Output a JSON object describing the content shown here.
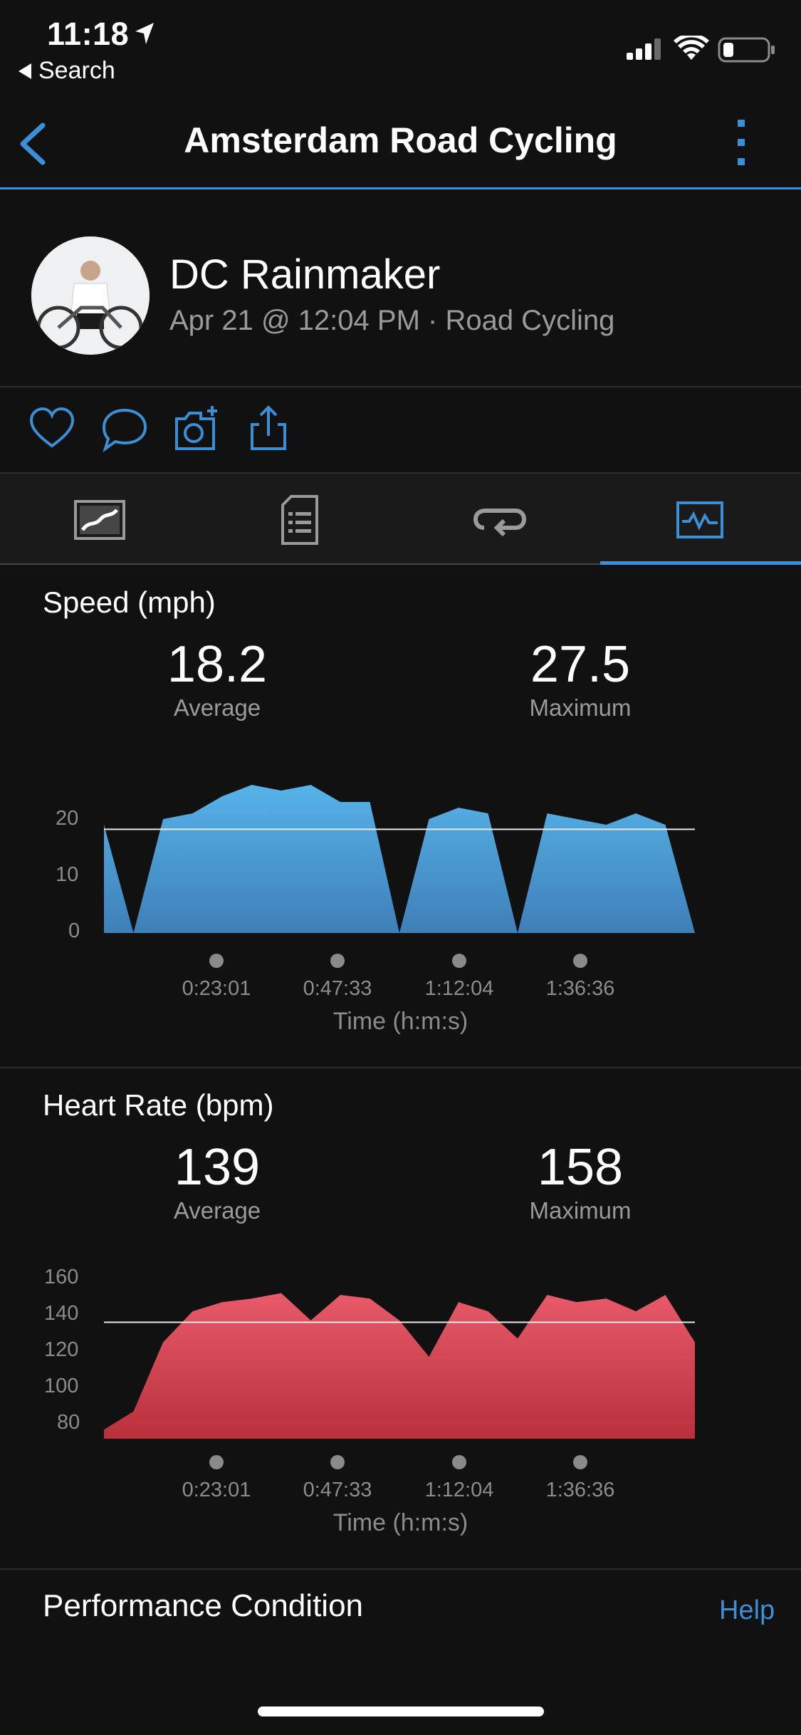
{
  "status_bar": {
    "time": "11:18",
    "back_label": "Search"
  },
  "nav": {
    "title": "Amsterdam Road Cycling"
  },
  "activity": {
    "user_name": "DC Rainmaker",
    "subtitle": "Apr 21 @ 12:04 PM · Road Cycling"
  },
  "colors": {
    "accent": "#3a8fd6",
    "speed_fill": "#4a9fd8",
    "hr_fill": "#d94655"
  },
  "speed": {
    "title": "Speed (mph)",
    "average_value": "18.2",
    "average_label": "Average",
    "maximum_value": "27.5",
    "maximum_label": "Maximum",
    "y_ticks": [
      "20",
      "10",
      "0"
    ],
    "x_ticks": [
      "0:23:01",
      "0:47:33",
      "1:12:04",
      "1:36:36"
    ],
    "x_title": "Time (h:m:s)"
  },
  "heart_rate": {
    "title": "Heart Rate (bpm)",
    "average_value": "139",
    "average_label": "Average",
    "maximum_value": "158",
    "maximum_label": "Maximum",
    "y_ticks": [
      "160",
      "140",
      "120",
      "100",
      "80"
    ],
    "x_ticks": [
      "0:23:01",
      "0:47:33",
      "1:12:04",
      "1:36:36"
    ],
    "x_title": "Time (h:m:s)"
  },
  "footer": {
    "section_title": "Performance Condition",
    "help_label": "Help"
  },
  "chart_data": [
    {
      "type": "area",
      "title": "Speed (mph)",
      "xlabel": "Time (h:m:s)",
      "ylabel": "",
      "ylim": [
        0,
        27.5
      ],
      "average_line": 18.2,
      "x": [
        0,
        0.05,
        0.1,
        0.15,
        0.2,
        0.25,
        0.3,
        0.35,
        0.4,
        0.45,
        0.5,
        0.55,
        0.6,
        0.65,
        0.7,
        0.75,
        0.8,
        0.85,
        0.9,
        0.95,
        1
      ],
      "values": [
        19,
        0,
        20,
        21,
        24,
        26,
        25,
        26,
        23,
        23,
        0,
        20,
        22,
        21,
        0,
        21,
        20,
        19,
        21,
        19,
        0
      ]
    },
    {
      "type": "area",
      "title": "Heart Rate (bpm)",
      "xlabel": "Time (h:m:s)",
      "ylabel": "",
      "ylim": [
        75,
        165
      ],
      "average_line": 139,
      "x": [
        0,
        0.05,
        0.1,
        0.15,
        0.2,
        0.25,
        0.3,
        0.35,
        0.4,
        0.45,
        0.5,
        0.55,
        0.6,
        0.65,
        0.7,
        0.75,
        0.8,
        0.85,
        0.9,
        0.95,
        1
      ],
      "values": [
        80,
        90,
        128,
        145,
        150,
        152,
        155,
        140,
        154,
        152,
        140,
        120,
        150,
        145,
        130,
        154,
        150,
        152,
        145,
        154,
        128
      ]
    }
  ]
}
